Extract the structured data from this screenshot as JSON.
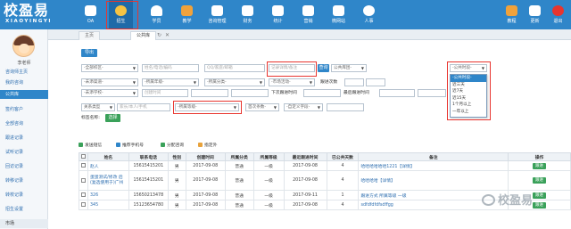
{
  "app": {
    "logo_cn": "校盈易",
    "logo_en": "XIAOYINGYI"
  },
  "nav": {
    "items": [
      {
        "label": "OA",
        "color": "#ffffff"
      },
      {
        "label": "招生",
        "color": "#f6c343"
      },
      {
        "label": "学员",
        "color": "#ffffff"
      },
      {
        "label": "教学",
        "color": "#f0a23b"
      },
      {
        "label": "咨询管理",
        "color": "#ffffff"
      },
      {
        "label": "财务",
        "color": "#ffffff"
      },
      {
        "label": "统计",
        "color": "#ffffff"
      },
      {
        "label": "营销",
        "color": "#ffffff"
      },
      {
        "label": "微网站",
        "color": "#ffffff"
      },
      {
        "label": "人事",
        "color": "#ffffff"
      }
    ],
    "right_items": [
      {
        "label": "教程",
        "color": "#f0a23b"
      },
      {
        "label": "更新",
        "color": "#ffffff"
      },
      {
        "label": "退出",
        "color": "#e8352f"
      }
    ]
  },
  "sidebar": {
    "user": "李老师",
    "items": [
      {
        "label": "咨询师主页"
      },
      {
        "label": "我的咨询"
      },
      {
        "label": "公共库"
      },
      {
        "label": "签约客户"
      },
      {
        "label": "全部咨询"
      },
      {
        "label": "跟进记录"
      },
      {
        "label": "试听记录"
      },
      {
        "label": "回访记录"
      },
      {
        "label": "转移记录"
      },
      {
        "label": "转校记录"
      },
      {
        "label": "招生设置"
      },
      {
        "label": "市场"
      }
    ]
  },
  "tabs": [
    {
      "label": "主页"
    },
    {
      "label": "公共库"
    }
  ],
  "export_label": "导出",
  "filters": {
    "row1": [
      "-全部校区-",
      "姓名/电话/编码",
      "QQ/家庭/邮箱",
      "记录详情/备注",
      "公共库团-",
      "-公共时段-"
    ],
    "query": "查询",
    "row2": [
      "-未添渠道-",
      "-所属年级-",
      "-所属分类-",
      "-市场活动-"
    ],
    "followup_label": "跟进次数",
    "row3_label_a": "创建时间",
    "row3_label_b": "下次跟进时间",
    "row3_label_c": "最后跟进时间",
    "row3": [
      "-未添学校-"
    ],
    "relation_label": "关系类型",
    "relation_ph": "家长/本人/手机",
    "level": "-所属等级-",
    "extra_a": "首次条数-",
    "extra_b": "-自定义字段-",
    "tag_label": "标签名称:",
    "tag_btn": "选择",
    "range_from": "开始",
    "range_to": "至"
  },
  "dropdown": {
    "options": [
      "-公共时段-",
      "近三天",
      "近7天",
      "近15天",
      "1个月以上",
      "一年以上"
    ]
  },
  "actions": [
    {
      "label": "发送短信",
      "color": "#3aa15a"
    },
    {
      "label": "推荐手机号",
      "color": "#2f86c9"
    },
    {
      "label": "分配咨询",
      "color": "#3aa15a"
    },
    {
      "label": "指定外",
      "color": "#e8a23b"
    }
  ],
  "table": {
    "headers": [
      "",
      "姓名",
      "联系电话",
      "性别",
      "创建时间",
      "所属分类",
      "所属等级",
      "最近跟进时间",
      "已公共天数",
      "备注",
      "操作"
    ],
    "rows": [
      {
        "no": "7",
        "name": "赵人",
        "phone": "15615415201",
        "gender": "男",
        "created": "2017-09-08",
        "cat": "普通",
        "level": "一级",
        "last": "2017-09-08",
        "days": "4",
        "remark": "哈哈哈哈哈哈1221【详情】",
        "op": "跟进"
      },
      {
        "no": "8",
        "name": "蛋蛋测试/修改 后(复选使用于)广州",
        "phone": "15615415201",
        "gender": "男",
        "created": "2017-09-08",
        "cat": "普通",
        "level": "一级",
        "last": "2017-09-08",
        "days": "4",
        "remark": "哈哈哈哈【详情】",
        "op": "跟进"
      },
      {
        "no": "9",
        "name": "326",
        "phone": "15650213478",
        "gender": "男",
        "created": "2017-09-08",
        "cat": "普通",
        "level": "一级",
        "last": "2017-09-11",
        "days": "1",
        "remark": "跟进方式 所属等级 一级",
        "op": "跟进"
      },
      {
        "no": "10",
        "name": "345",
        "phone": "15123654780",
        "gender": "男",
        "created": "2017-09-08",
        "cat": "普通",
        "level": "一级",
        "last": "2017-09-08",
        "days": "4",
        "remark": "sdfdfdfdfsdffgg",
        "op": "跟进"
      }
    ]
  },
  "watermark": "校盈易"
}
